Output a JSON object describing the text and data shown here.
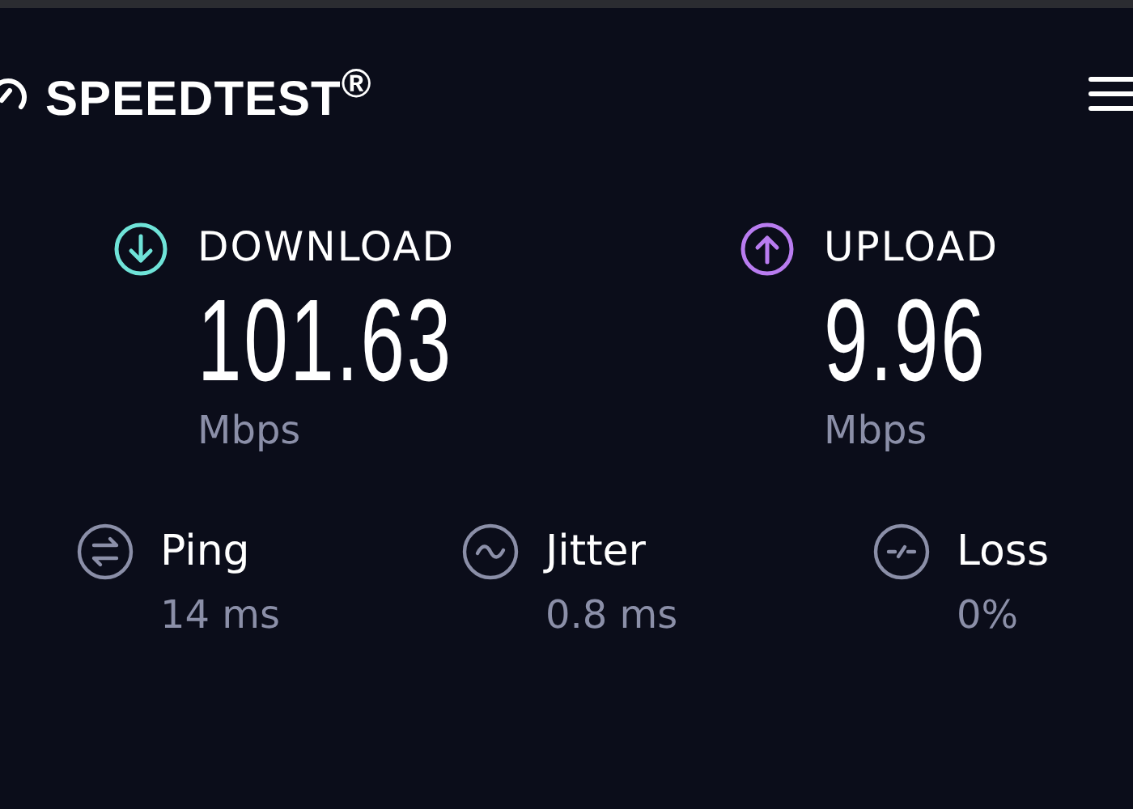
{
  "header": {
    "logo": "SPEEDTEST$^{®}$"
  },
  "results": [
    {
      "kind": "download",
      "label": "DOWNLOAD",
      "value": "101.63",
      "unit": "Mbps",
      "color": "#6fe3d8"
    },
    {
      "kind": "upload",
      "label": "UPLOAD",
      "value": "9.96",
      "unit": "Mbps",
      "color": "#b97cf0"
    }
  ],
  "stats": [
    {
      "kind": "ping",
      "label": "Ping",
      "value": "14 ms"
    },
    {
      "kind": "jitter",
      "label": "Jitter",
      "value": "0.8 ms"
    },
    {
      "kind": "loss",
      "label": "Loss",
      "value": "0%"
    }
  ]
}
